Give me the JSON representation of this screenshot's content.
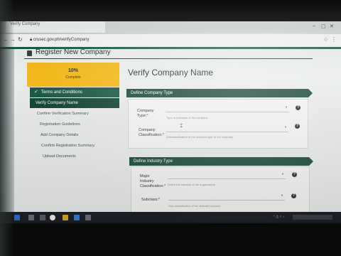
{
  "browser": {
    "tab_title": "Verify Company",
    "url": "crusec.gov.ph/verifyCompany"
  },
  "header": {
    "title": "Register New Company"
  },
  "sidebar": {
    "progress_percent": "10%",
    "progress_label": "Complete",
    "items": [
      {
        "label": "Terms and Conditions",
        "state": "done"
      },
      {
        "label": "Verify Company Name",
        "state": "active"
      },
      {
        "label": "Confirm Verification Summary",
        "state": "pending"
      },
      {
        "label": "Registration Guidelines",
        "state": "pending"
      },
      {
        "label": "Add Company Details",
        "state": "pending"
      },
      {
        "label": "Confirm Registration Summary",
        "state": "pending"
      },
      {
        "label": "Upload Documents",
        "state": "pending"
      }
    ]
  },
  "main": {
    "title": "Verify Company Name",
    "sections": [
      {
        "heading": "Define Company Type",
        "fields": [
          {
            "label_line1": "Company",
            "label_line2": "Type:",
            "required": "*",
            "hint": "Type of business of the company"
          },
          {
            "label_line1": "Company",
            "label_line2": "Classification:",
            "required": "*",
            "hint": "Subclassification of the selected type of the company"
          }
        ]
      },
      {
        "heading": "Define Industry Type",
        "fields": [
          {
            "label_line1": "Major",
            "label_line2": "Industry",
            "label_line3": "Classification:",
            "required": "*",
            "hint": "Select the industry of the organization"
          },
          {
            "label_line1": "Subclass:",
            "required": "*",
            "hint": "Sub-classification of the selected industry"
          }
        ]
      }
    ]
  },
  "help_glyph": "?",
  "colors": {
    "accent_green": "#1c4c3f",
    "progress_yellow": "#f2b81b",
    "sidebar_active": "#1f5a47"
  }
}
